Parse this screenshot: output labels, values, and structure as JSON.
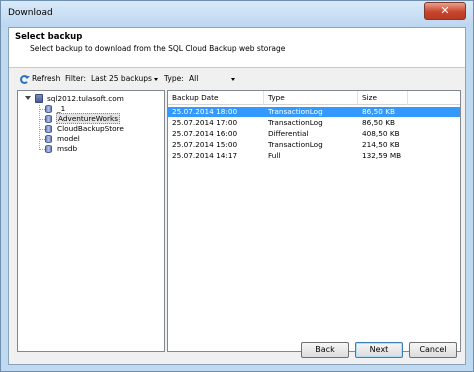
{
  "window": {
    "title": "Download",
    "close_glyph": "✕"
  },
  "header": {
    "title": "Select backup",
    "subtitle": "Select backup to download from the SQL Cloud Backup web storage"
  },
  "toolbar": {
    "refresh_label": "Refresh",
    "filter_label": "Filter:",
    "filter_value": "Last 25 backups",
    "type_label": "Type:",
    "type_value": "All"
  },
  "tree": {
    "server": "sql2012.tulasoft.com",
    "databases": [
      "_1",
      "AdventureWorks",
      "CloudBackupStore",
      "model",
      "msdb"
    ],
    "selected": "AdventureWorks"
  },
  "grid": {
    "columns": [
      "Backup Date",
      "Type",
      "Size"
    ],
    "rows": [
      [
        "25.07.2014 18:00",
        "TransactionLog",
        "86,50 KB"
      ],
      [
        "25.07.2014 17:00",
        "TransactionLog",
        "86,50 KB"
      ],
      [
        "25.07.2014 16:00",
        "Differential",
        "408,50 KB"
      ],
      [
        "25.07.2014 15:00",
        "TransactionLog",
        "214,50 KB"
      ],
      [
        "25.07.2014 14:17",
        "Full",
        "132,59 MB"
      ]
    ],
    "selected_row": 0
  },
  "buttons": {
    "back_label": "Back",
    "next_label": "Next",
    "cancel_label": "Cancel"
  },
  "colors": {
    "selection": "#3399ff",
    "title_bar": "#bfd9f1",
    "close_button": "#c8452c"
  }
}
